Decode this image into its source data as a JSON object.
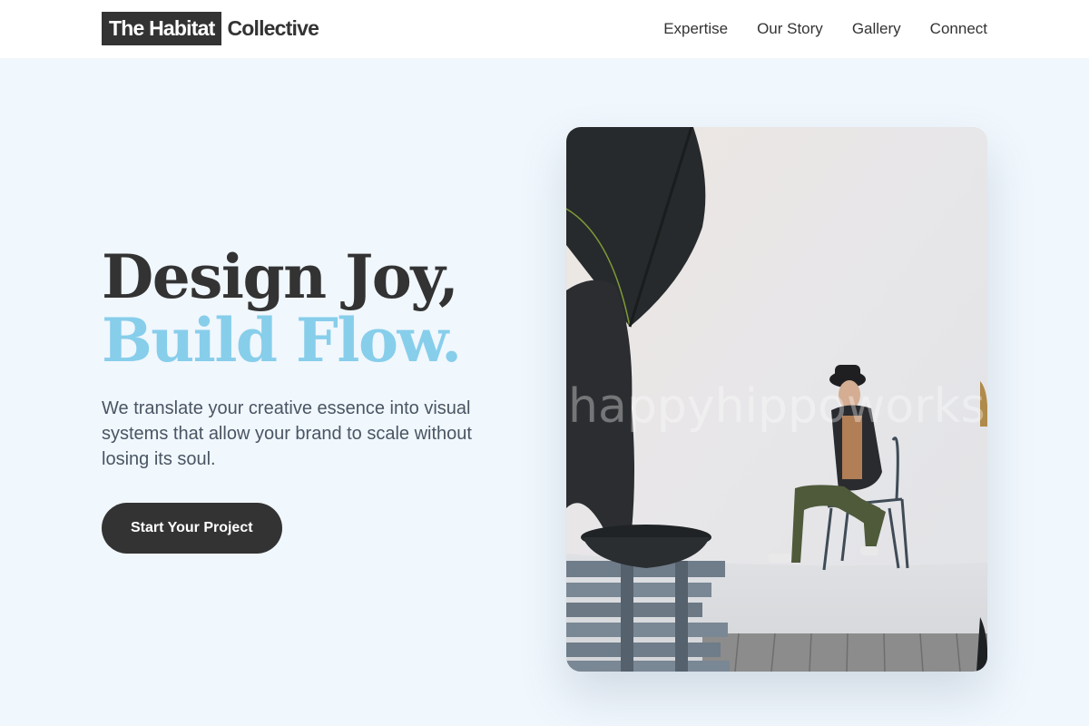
{
  "brand": {
    "highlight": "The Habitat",
    "rest": "Collective"
  },
  "nav": {
    "items": [
      {
        "label": "Expertise"
      },
      {
        "label": "Our Story"
      },
      {
        "label": "Gallery"
      },
      {
        "label": "Connect"
      }
    ]
  },
  "hero": {
    "headline_line1": "Design Joy,",
    "headline_line2": "Build Flow.",
    "subtext": "We translate your creative essence into visual systems that allow your brand to scale without losing its soul.",
    "cta_label": "Start Your Project",
    "image": {
      "watermark": "happyhippoworks"
    }
  },
  "colors": {
    "page_background": "#f0f7fd",
    "dark": "#333333",
    "accent": "#87ceeb",
    "body_text": "#4a5563"
  }
}
